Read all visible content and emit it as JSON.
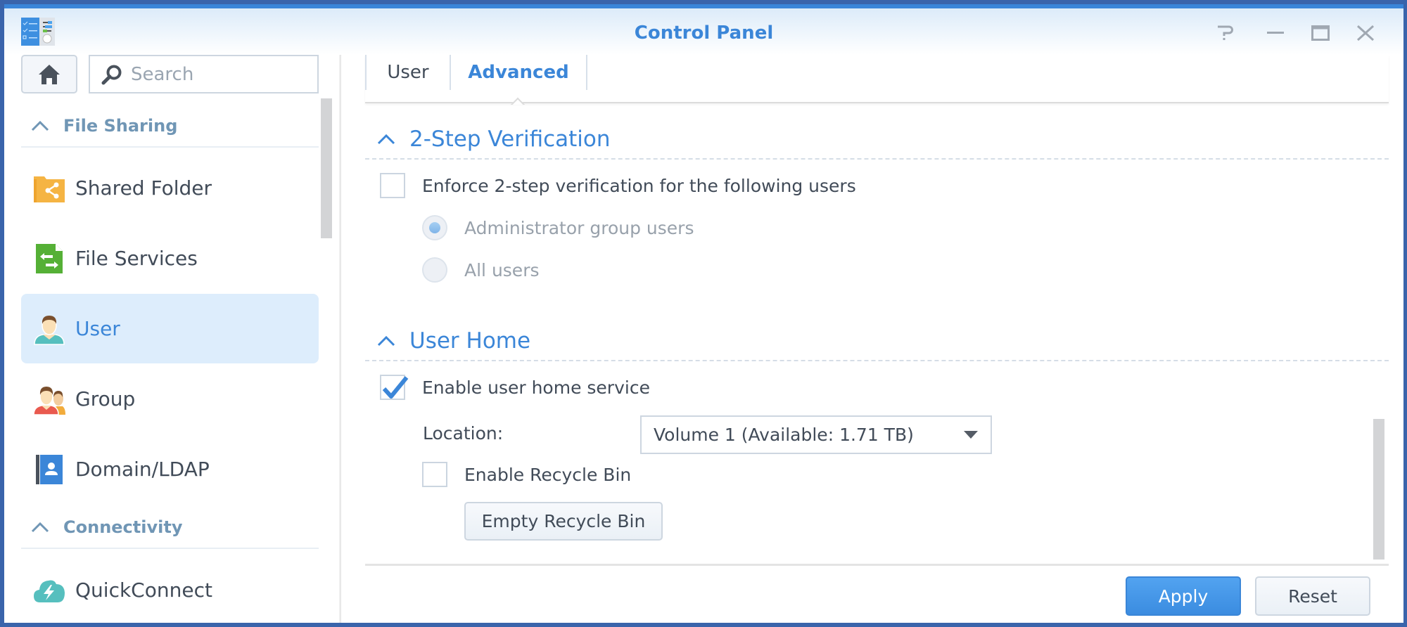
{
  "window": {
    "title": "Control Panel",
    "app_icon": "control-panel-icon",
    "controls": [
      {
        "name": "help",
        "icon": "help-icon"
      },
      {
        "name": "minimize",
        "icon": "minimize-icon"
      },
      {
        "name": "maximize",
        "icon": "maximize-icon"
      },
      {
        "name": "close",
        "icon": "close-icon"
      }
    ]
  },
  "sidebar": {
    "home_icon": "home-icon",
    "search": {
      "placeholder": "Search",
      "value": ""
    },
    "groups": [
      {
        "label": "File Sharing",
        "expanded": true,
        "items": [
          {
            "label": "Shared Folder",
            "icon": "shared-folder-icon",
            "active": false
          },
          {
            "label": "File Services",
            "icon": "file-services-icon",
            "active": false
          },
          {
            "label": "User",
            "icon": "user-icon",
            "active": true
          },
          {
            "label": "Group",
            "icon": "group-icon",
            "active": false
          },
          {
            "label": "Domain/LDAP",
            "icon": "domain-ldap-icon",
            "active": false
          }
        ]
      },
      {
        "label": "Connectivity",
        "expanded": true,
        "items": [
          {
            "label": "QuickConnect",
            "icon": "quickconnect-icon",
            "active": false
          }
        ]
      }
    ]
  },
  "main": {
    "tabs": [
      {
        "label": "User",
        "active": false
      },
      {
        "label": "Advanced",
        "active": true
      }
    ],
    "sections": {
      "two_step": {
        "title": "2-Step Verification",
        "enforce": {
          "label": "Enforce 2-step verification for the following users",
          "checked": false
        },
        "options": [
          {
            "label": "Administrator group users",
            "selected": true,
            "disabled": true
          },
          {
            "label": "All users",
            "selected": false,
            "disabled": true
          }
        ]
      },
      "user_home": {
        "title": "User Home",
        "enable": {
          "label": "Enable user home service",
          "checked": true
        },
        "location": {
          "label": "Location:",
          "value": "Volume 1 (Available: 1.71 TB)"
        },
        "recycle": {
          "label": "Enable Recycle Bin",
          "checked": false
        },
        "empty_button": "Empty Recycle Bin"
      }
    },
    "footer": {
      "apply": "Apply",
      "reset": "Reset"
    }
  },
  "colors": {
    "accent": "#3b86d8",
    "selected_bg": "#ddedfc",
    "group_header": "#7096b5",
    "text": "#414b58"
  }
}
